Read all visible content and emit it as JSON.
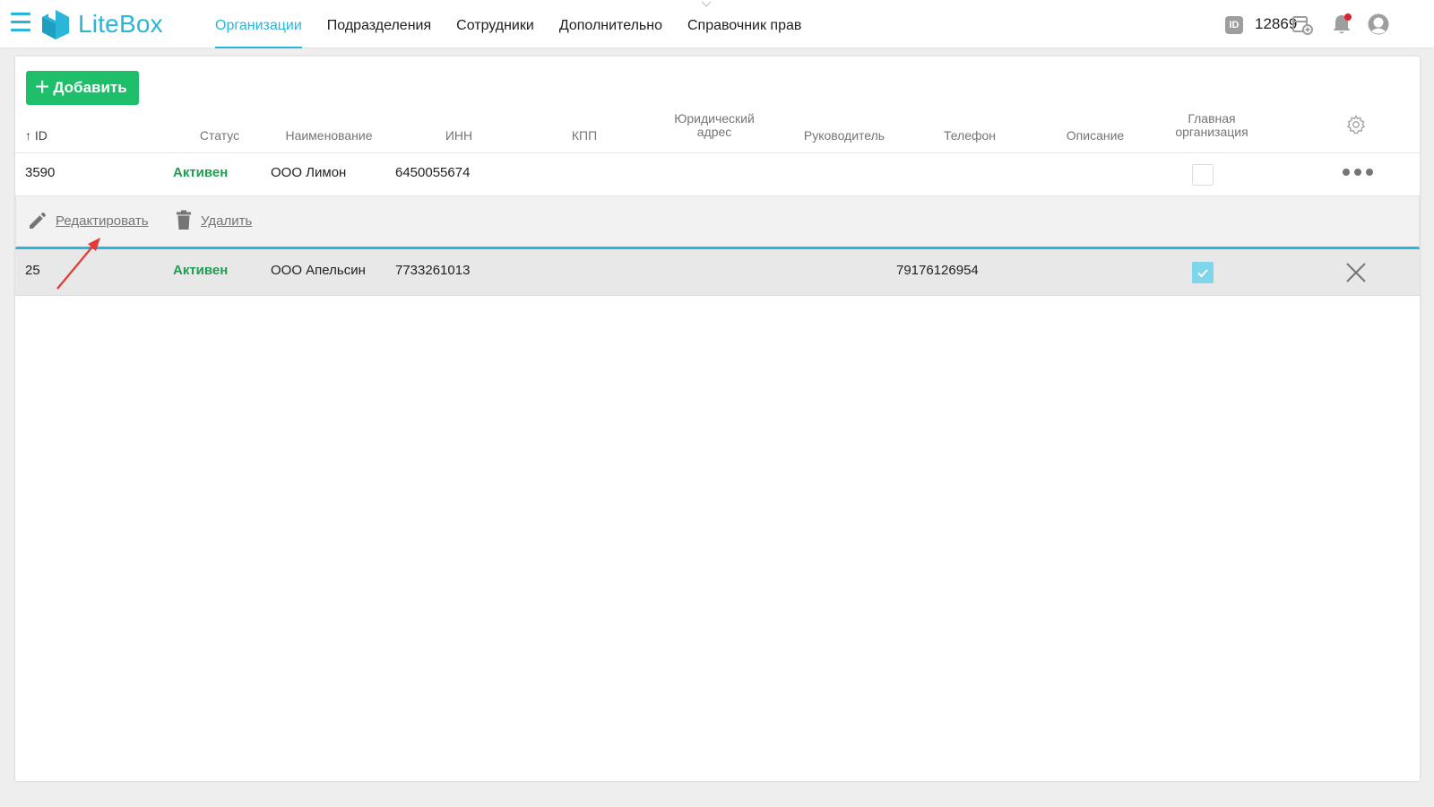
{
  "app": {
    "logo_text": "LiteBox",
    "accent_color": "#29b6d9",
    "add_color": "#1fbe6a",
    "status_color": "#1f9e4f"
  },
  "nav": {
    "items": [
      {
        "label": "Организации",
        "active": true
      },
      {
        "label": "Подразделения",
        "active": false
      },
      {
        "label": "Сотрудники",
        "active": false
      },
      {
        "label": "Дополнительно",
        "active": false
      },
      {
        "label": "Справочник прав",
        "active": false
      }
    ]
  },
  "header_right": {
    "id_badge": "ID",
    "id_number": "12869",
    "icons": [
      "register-add-icon",
      "bell-icon",
      "user-avatar-icon"
    ],
    "notification_dot": true
  },
  "toolbar": {
    "add_label": "Добавить",
    "add_icon": "plus-icon"
  },
  "table": {
    "columns": {
      "id": "ID",
      "status": "Статус",
      "name": "Наименование",
      "inn": "ИНН",
      "kpp": "КПП",
      "legal_address_1": "Юридический",
      "legal_address_2": "адрес",
      "director": "Руководитель",
      "phone": "Телефон",
      "description": "Описание",
      "main_org_1": "Главная",
      "main_org_2": "организация"
    },
    "sort": {
      "column": "ID",
      "direction": "ascending",
      "icon": "arrow-up-icon"
    },
    "settings_icon": "gear-icon",
    "rows": [
      {
        "id": "3590",
        "status": "Активен",
        "name": "ООО Лимон",
        "inn": "6450055674",
        "kpp": "",
        "legal_address": "",
        "director": "",
        "phone": "",
        "description": "",
        "main_org": false,
        "row_action_icon": "more-dots-icon"
      },
      {
        "id": "25",
        "status": "Активен",
        "name": "ООО Апельсин",
        "inn": "7733261013",
        "kpp": "",
        "legal_address": "",
        "director": "",
        "phone": "79176126954",
        "description": "",
        "main_org": true,
        "row_action_icon": "close-icon"
      }
    ]
  },
  "row_actions": {
    "edit_label": "Редактировать",
    "edit_icon": "pencil-icon",
    "delete_label": "Удалить",
    "delete_icon": "trash-icon"
  },
  "annotation": {
    "type": "red-arrow",
    "points_to": "edit-action",
    "color": "#e53935"
  }
}
